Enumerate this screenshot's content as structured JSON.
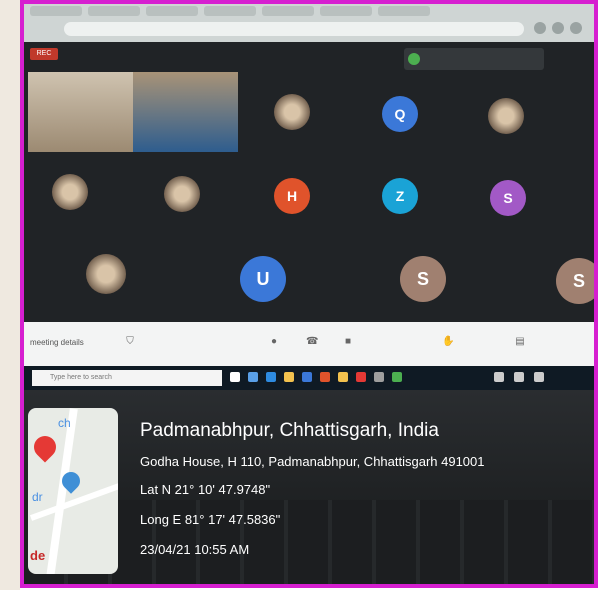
{
  "meeting": {
    "rec_label": "REC",
    "participants": [
      {
        "initial": "Q",
        "color": "#3b78d8"
      },
      {
        "initial": "H",
        "color": "#e0532b"
      },
      {
        "initial": "Z",
        "color": "#1aa3d6"
      },
      {
        "initial": "S",
        "color": "#a259c6"
      },
      {
        "initial": "U",
        "color": "#3b78d8"
      },
      {
        "initial": "S",
        "color": "#a08070"
      },
      {
        "initial": "S",
        "color": "#a08070"
      }
    ],
    "details_label": "meeting details"
  },
  "taskbar": {
    "search_placeholder": "Type here to search"
  },
  "geotag": {
    "place": "Padmanabhpur, Chhattisgarh, India",
    "address": "Godha House, H 110, Padmanabhpur, Chhattisgarh 491001",
    "lat": "Lat N 21° 10' 47.9748\"",
    "long": "Long E 81° 17' 47.5836\"",
    "datetime": "23/04/21 10:55 AM"
  },
  "map": {
    "label_ch": "ch",
    "label_dr": "dr",
    "label_de": "de"
  },
  "colors": {
    "frame": "#d61fd0"
  }
}
